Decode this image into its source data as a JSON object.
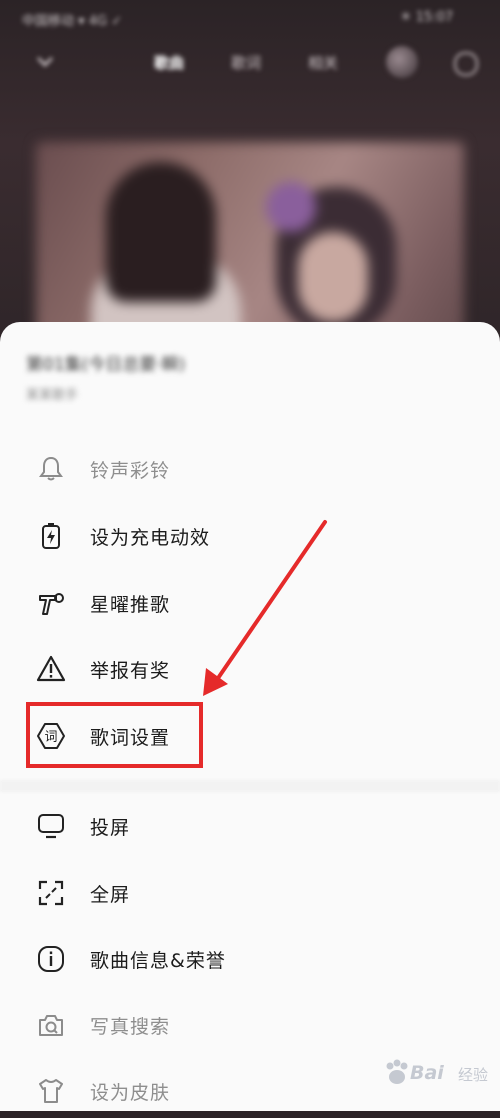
{
  "status_bar": {
    "left": "中国移动 ▾ 4G ✓",
    "right": "☀ 15:07"
  },
  "top_nav": {
    "tabs": [
      "歌曲",
      "歌词",
      "相关"
    ]
  },
  "song": {
    "title": "第01集(今日总要·瞬)",
    "subtitle": "某某歌手"
  },
  "menu": {
    "items": [
      {
        "label": "铃声彩铃",
        "icon": "bell-icon",
        "dim": true
      },
      {
        "label": "设为充电动效",
        "icon": "battery-charge-icon",
        "dim": false
      },
      {
        "label": "星曜推歌",
        "icon": "megaphone-icon",
        "dim": false
      },
      {
        "label": "举报有奖",
        "icon": "warning-triangle-icon",
        "dim": false
      },
      {
        "label": "歌词设置",
        "icon": "lyrics-badge-icon",
        "icon_text": "词",
        "dim": false,
        "highlighted": true
      },
      {
        "label": "投屏",
        "icon": "cast-screen-icon",
        "dim": false
      },
      {
        "label": "全屏",
        "icon": "fullscreen-icon",
        "dim": false
      },
      {
        "label": "歌曲信息&荣誉",
        "icon": "info-icon",
        "dim": false
      },
      {
        "label": "写真搜索",
        "icon": "camera-search-icon",
        "dim": true
      },
      {
        "label": "设为皮肤",
        "icon": "tshirt-icon",
        "dim": true
      }
    ]
  },
  "annotation": {
    "color": "#e52a2a"
  },
  "watermark": {
    "brand": "Bai",
    "text": "经验"
  }
}
